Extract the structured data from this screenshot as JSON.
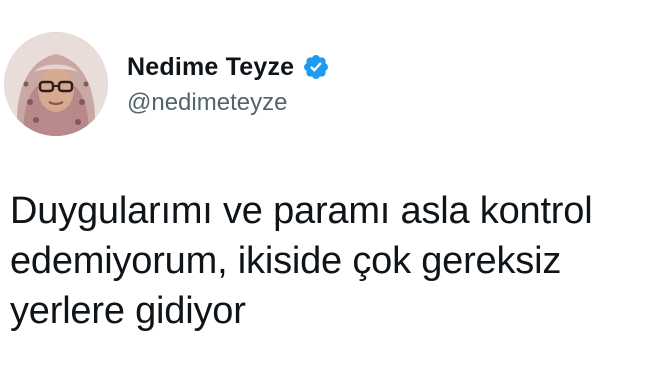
{
  "author": {
    "display_name": "Nedime Teyze",
    "handle": "@nedimeteyze",
    "verified_icon": "verified-badge-icon",
    "avatar_icon": "profile-photo"
  },
  "tweet": {
    "lines": [
      "Duygularımı ve paramı asla kontrol",
      "edemiyorum, ikiside çok gereksiz",
      "yerlere gidiyor"
    ]
  },
  "colors": {
    "text": "#0f1419",
    "handle": "#536471",
    "verified": "#1d9bf0",
    "background": "#ffffff"
  }
}
